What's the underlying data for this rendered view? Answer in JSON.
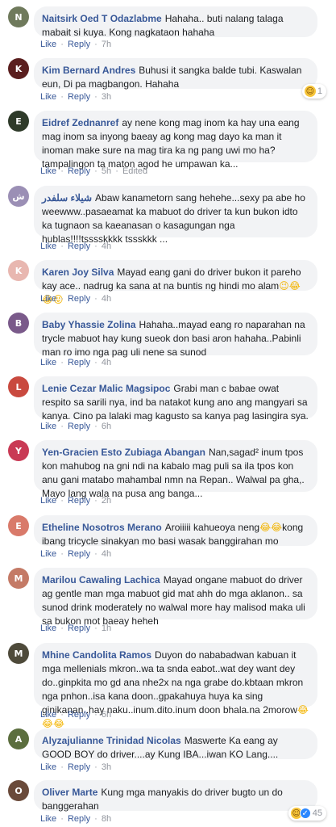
{
  "actions": {
    "like": "Like",
    "reply": "Reply",
    "sep": "·"
  },
  "comments": [
    {
      "author": "Naitsirk Oed T Odazlabme",
      "text": "Hahaha.. buti nalang talaga mabait si kuya. Kong nagkataon hahaha",
      "emoji": "",
      "time": "7h",
      "edited": "",
      "avatar_color": "#6f7a5c",
      "avatar_initial": "N",
      "reactions": null
    },
    {
      "author": "Kim Bernard Andres",
      "text": "Buhusi it sangka balde tubi. Kaswalan eun, Di pa magbangon. Hahaha",
      "emoji": "",
      "time": "3h",
      "edited": "",
      "avatar_color": "#5a1e1e",
      "avatar_initial": "K",
      "reactions": {
        "icon": "haha-icon",
        "count": "1"
      }
    },
    {
      "author": "Eidref Zednanref",
      "text": "ay nene kong mag inom ka hay una eang mag inom sa inyong baeay ag kong mag dayo ka man it inoman make sure na mag tira ka ng pang uwi mo ha? tampalingon ta maton agod he umpawan ka...",
      "emoji": "",
      "time": "5h",
      "edited": "Edited",
      "avatar_color": "#2f3b2a",
      "avatar_initial": "E",
      "reactions": null
    },
    {
      "author": "شيلاء سلفدر",
      "text": "Abaw kanametorn sang hehehe...sexy pa abe ho weewww..pasaeamat ka mabuot do driver ta kun bukon idto ka tugnaon sa kaeanasan o kasagungan nga hublas!!!!tsssskkkk tssskkk ...",
      "emoji": "",
      "time": "4h",
      "edited": "",
      "avatar_color": "#9b8fb5",
      "avatar_initial": "ش",
      "reactions": null
    },
    {
      "author": "Karen Joy Silva",
      "text": "Mayad eang gani do driver bukon it pareho kay ace.. nadrug ka sana at na buntis ng hindi mo alam",
      "emoji": "😉😂😂😝",
      "time": "4h",
      "edited": "",
      "avatar_color": "#e8b7b0",
      "avatar_initial": "K",
      "reactions": null
    },
    {
      "author": "Baby Yhassie Zolina",
      "text": "Hahaha..mayad eang ro naparahan na trycle mabuot hay kung sueok don basi aron hahaha..Pabinli man ro imo nga pag uli nene sa sunod",
      "emoji": "",
      "time": "4h",
      "edited": "",
      "avatar_color": "#7a5a8a",
      "avatar_initial": "B",
      "reactions": null
    },
    {
      "author": "Lenie Cezar Malic Magsipoc",
      "text": "Grabi man c babae owat respito sa sarili nya, ind ba natakot kung ano ang mangyari sa kanya. Cino pa lalaki mag kagusto sa kanya pag lasingira sya.",
      "emoji": "",
      "time": "6h",
      "edited": "",
      "avatar_color": "#c94a3f",
      "avatar_initial": "L",
      "reactions": null
    },
    {
      "author": "Yen-Gracien Esto Zubiaga Abangan",
      "text": "Nan,sagad² inum tpos kon mahubog na gni ndi na kabalo mag puli sa ila tpos kon anu gani matabo mahambal nmn na Repan.. Walwal pa gha,. Mayo lang wala na pusa ang banga...",
      "emoji": "",
      "time": "2h",
      "edited": "",
      "avatar_color": "#c93a55",
      "avatar_initial": "Y",
      "reactions": null
    },
    {
      "author": "Etheline Nosotros Merano",
      "text": "Aroiiiii kahueoya neng",
      "text2": "kong ibang tricycle sinakyan mo basi wasak banggirahan mo",
      "emoji": "😂😂",
      "time": "4h",
      "edited": "",
      "avatar_color": "#d97a6a",
      "avatar_initial": "E",
      "reactions": null
    },
    {
      "author": "Marilou Cawaling Lachica",
      "text": "Mayad ongane mabuot do driver ag gentle man mga mabuot gid mat ahh do mga aklanon.. sa sunod drink moderately no walwal more hay malisod maka uli sa bukon mot baeay heheh",
      "emoji": "",
      "time": "1h",
      "edited": "",
      "avatar_color": "#c47a66",
      "avatar_initial": "M",
      "reactions": null
    },
    {
      "author": "Mhine Candolita Ramos",
      "text": "Duyon do nababadwan kabuan it mga mellenials mkron..wa ta snda eabot..wat dey want dey do..ginpkita mo gd ana nhe2x na nga grabe do.kbtaan mkron nga pnhon..isa kana doon..gpakahuya huya ka sing ginikanan..hay naku..inum.dito.inum doon bhala.na 2morow",
      "emoji": "😂😂😂",
      "time": "6h",
      "edited": "",
      "avatar_color": "#4e4a3a",
      "avatar_initial": "M",
      "reactions": null
    },
    {
      "author": "Alyzajulianne Trinidad Nicolas",
      "text": "Maswerte Ka eang ay GOOD BOY do driver....ay Kung IBA...iwan KO Lang....",
      "emoji": "",
      "time": "3h",
      "edited": "",
      "avatar_color": "#5b6e3e",
      "avatar_initial": "A",
      "reactions": null
    },
    {
      "author": "Oliver Marte",
      "text": "Kung mga manyakis do driver bugto un do banggerahan",
      "emoji": "",
      "time": "8h",
      "edited": "",
      "avatar_color": "#6a4a3a",
      "avatar_initial": "O",
      "reactions": {
        "icon": "haha-like-icon",
        "count": "45"
      }
    }
  ]
}
